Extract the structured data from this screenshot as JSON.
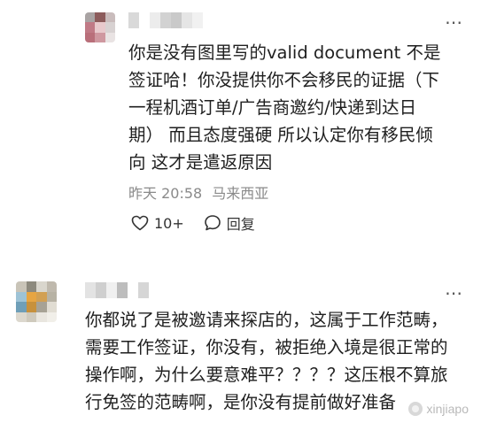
{
  "comments": [
    {
      "text_lines": [
        "你是没有图里写的valid document 不是",
        "签证哈！你没提供你不会移民的证据（下",
        "一程机酒订单/广告商邀约/快递到达日",
        "期） 而且态度强硬 所以认定你有移民倾",
        "向 这才是遣返原因"
      ],
      "time": "昨天 20:58",
      "location": "马来西亚",
      "likes": "10+",
      "reply_label": "回复",
      "more": "⋯"
    },
    {
      "text_lines": [
        "你都说了是被邀请来探店的，这属于工作范畴，",
        "需要工作签证，你没有，被拒绝入境是很正常的",
        "操作啊，为什么要意难平？？？？这压根不算旅",
        "行免签的范畴啊，是你没有提前做好准备"
      ],
      "more": "⋯"
    }
  ],
  "watermark": "xinjiapo",
  "icons": {
    "like": "heart-icon",
    "reply": "comment-bubble-icon",
    "more": "more-dots-icon"
  },
  "colors": {
    "text": "#1f1f1f",
    "meta": "#8a8a8a",
    "watermark": "#b9b9b9"
  }
}
